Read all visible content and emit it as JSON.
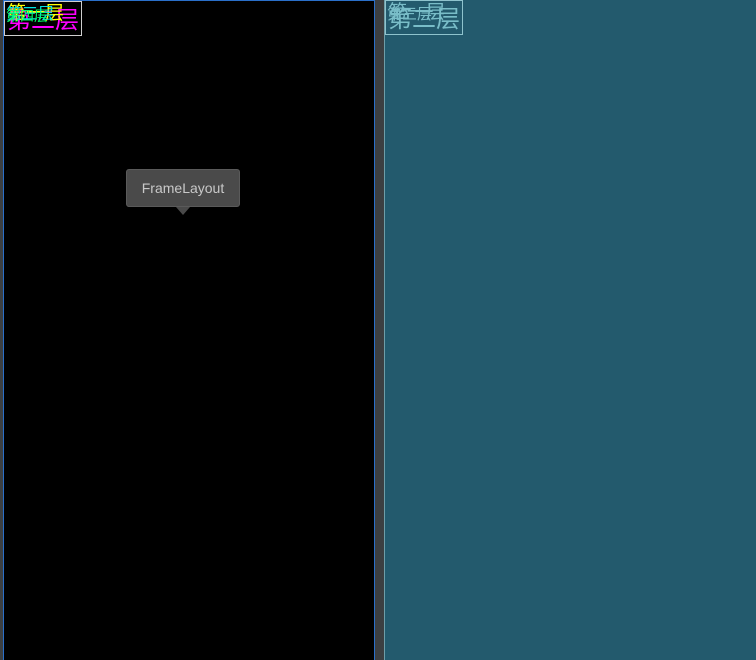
{
  "design": {
    "layers": {
      "yellow": "第一层",
      "magenta": "第二层",
      "cyan": "第三层",
      "green": "第四层"
    },
    "tooltip": "FrameLayout"
  },
  "blueprint": {
    "layers": {
      "l1": "第一层",
      "l2": "第二层",
      "l3": "第三层"
    }
  },
  "colors": {
    "design_background": "#000000",
    "blueprint_background": "#235a6d",
    "selection_border": "#2a6fc9"
  }
}
